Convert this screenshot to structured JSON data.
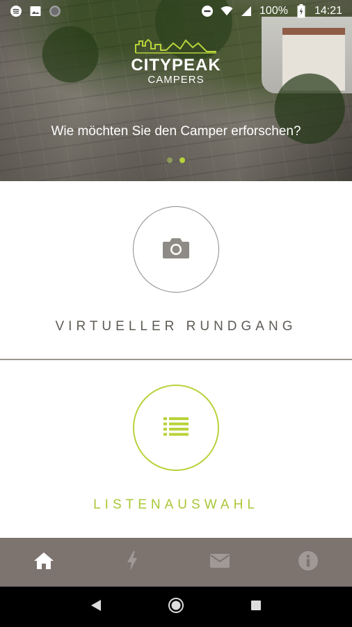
{
  "status_bar": {
    "battery": "100%",
    "time": "14:21",
    "left_icons": [
      "spotify-icon",
      "image-icon",
      "circle-icon"
    ],
    "right_icons": [
      "do-not-disturb-icon",
      "wifi-icon",
      "signal-icon",
      "battery-icon"
    ]
  },
  "header": {
    "logo_brand": "CITYPEAK",
    "logo_sub": "CAMPERS",
    "question": "Wie möchten Sie den Camper erforschen?",
    "pager": {
      "count": 2,
      "active_index": 1
    }
  },
  "options": [
    {
      "label": "VIRTUELLER RUNDGANG",
      "icon": "camera-icon",
      "color": "#5e5a55"
    },
    {
      "label": "LISTENAUSWAHL",
      "icon": "list-icon",
      "color": "#a9c735"
    }
  ],
  "bottom_nav": {
    "items": [
      {
        "name": "home",
        "icon": "home-icon",
        "active": true
      },
      {
        "name": "power",
        "icon": "lightning-icon",
        "active": false
      },
      {
        "name": "mail",
        "icon": "mail-icon",
        "active": false
      },
      {
        "name": "info",
        "icon": "info-icon",
        "active": false
      }
    ]
  },
  "colors": {
    "accent": "#b7d33a",
    "nav_bg": "#7d7470",
    "nav_inactive": "#a19995",
    "text_gray": "#5e5a55"
  }
}
